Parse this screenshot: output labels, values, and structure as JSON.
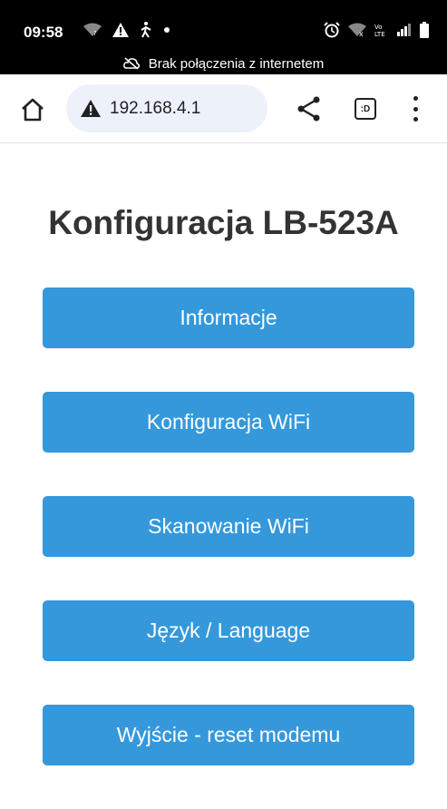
{
  "status_bar": {
    "time": "09:58",
    "left_icons": [
      "wifi-question-icon",
      "warning-icon",
      "walking-person-icon",
      "dot-icon"
    ],
    "right_icons": [
      "alarm-icon",
      "wifi-x-icon",
      "volte-icon",
      "signal-icon",
      "battery-icon"
    ],
    "volte_text": "Vo\nLTE",
    "offline_text": "Brak połączenia z internetem"
  },
  "browser": {
    "url": "192.168.4.1",
    "tabs_label": ":D"
  },
  "page": {
    "title": "Konfiguracja LB-523A",
    "buttons": [
      {
        "label": "Informacje"
      },
      {
        "label": "Konfiguracja WiFi"
      },
      {
        "label": "Skanowanie WiFi"
      },
      {
        "label": "Język / Language"
      },
      {
        "label": "Wyjście - reset modemu"
      }
    ]
  },
  "colors": {
    "button_bg": "#3498db",
    "button_text": "#ffffff",
    "title_text": "#333333",
    "status_bg": "#000000",
    "url_pill_bg": "#edf2fa"
  }
}
